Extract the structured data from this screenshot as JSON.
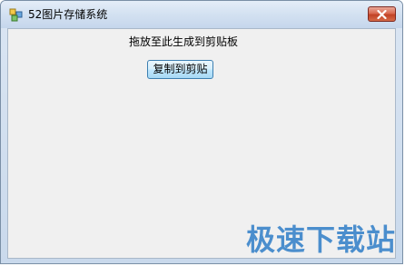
{
  "window": {
    "title": "52图片存储系统",
    "app_icon": "window-app-icon",
    "close_icon": "close-icon"
  },
  "main": {
    "hint_label": "拖放至此生成到剪贴板",
    "copy_button_label": "复制到剪贴"
  },
  "watermark": {
    "text": "极速下载站"
  },
  "colors": {
    "close_button": "#c8432a",
    "button_border": "#3c7fb1",
    "client_background": "#f0f0f0",
    "watermark": "#2f7ec8"
  }
}
